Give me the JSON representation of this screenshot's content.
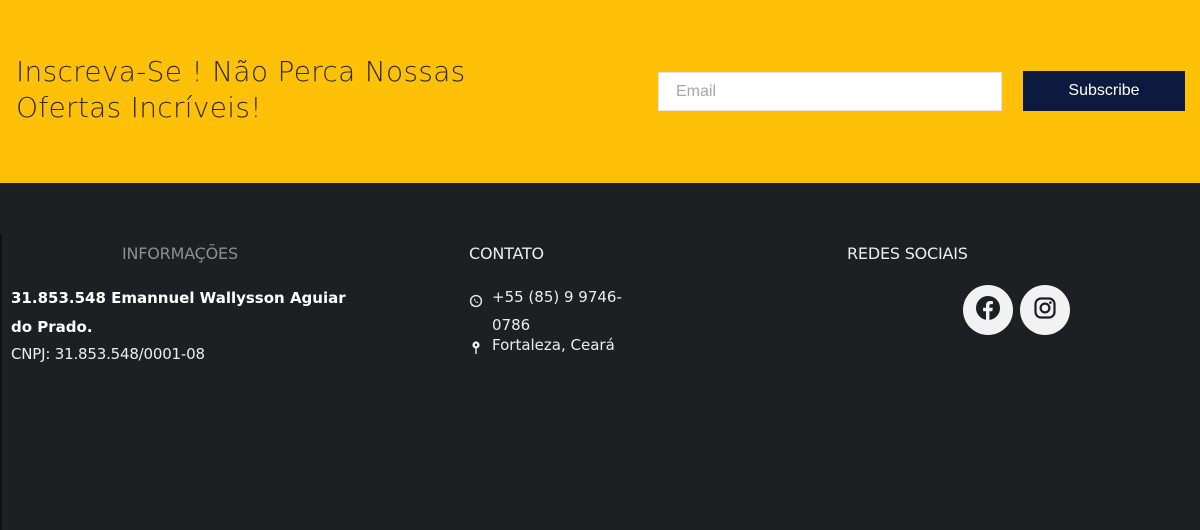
{
  "newsletter": {
    "title": "Inscreva-Se ! Não Perca Nossas Ofertas Incríveis!",
    "email_placeholder": "Email",
    "subscribe_label": "Subscribe"
  },
  "footer": {
    "info": {
      "heading": "INFORMAÇÕES",
      "company_name": "31.853.548 Emannuel Wallysson Aguiar do Prado.",
      "cnpj": "CNPJ: 31.853.548/0001-08"
    },
    "contato": {
      "heading": "CONTATO",
      "phone": "+55 (85) 9 9746-0786",
      "location": "Fortaleza, Ceará",
      "phone_icon": "whatsapp-icon",
      "location_icon": "map-pin-icon"
    },
    "redes": {
      "heading": "REDES SOCIAIS",
      "icons": [
        "facebook-icon",
        "instagram-icon"
      ]
    }
  },
  "colors": {
    "newsletter_bg": "#ffc107",
    "footer_bg": "#1e1f23",
    "button_bg": "#0d1a3f",
    "text_light": "#ececec",
    "heading_muted": "#8d8e92"
  }
}
